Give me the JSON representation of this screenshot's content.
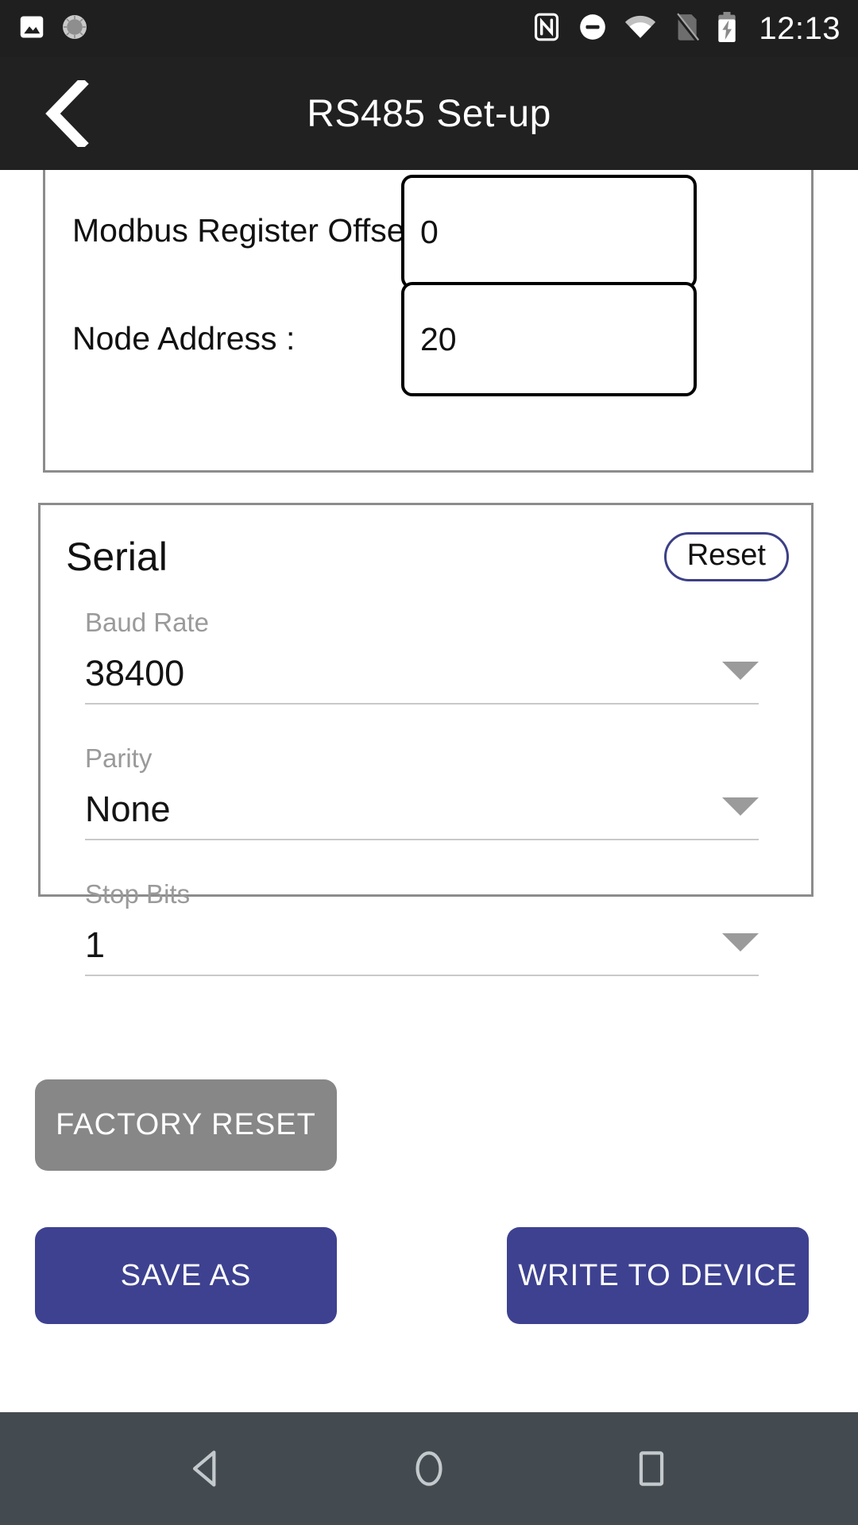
{
  "status_bar": {
    "icons_left": [
      "image-icon",
      "brightness-icon"
    ],
    "icons_right": [
      "nfc-icon",
      "do-not-disturb-icon",
      "wifi-icon",
      "no-sim-icon",
      "battery-charging-icon"
    ],
    "time": "12:13"
  },
  "app_bar": {
    "back_icon": "back-chevron-icon",
    "title": "RS485 Set-up"
  },
  "modbus_card": {
    "fields": [
      {
        "label": "Modbus Register Offset :",
        "value": "0",
        "placeholder": "0"
      },
      {
        "label": "Node Address :",
        "value": "20",
        "placeholder": "0"
      }
    ]
  },
  "serial_card": {
    "title": "Serial",
    "reset_label": "Reset",
    "selects": [
      {
        "label": "Baud Rate",
        "value": "38400",
        "caret": "chevron-down-icon"
      },
      {
        "label": "Parity",
        "value": "None",
        "caret": "chevron-down-icon"
      },
      {
        "label": "Stop Bits",
        "value": "1",
        "caret": "chevron-down-icon"
      }
    ]
  },
  "actions": {
    "factory_reset": "FACTORY RESET",
    "save_as": "SAVE AS",
    "write_to_device": "WRITE TO DEVICE"
  },
  "nav_bar": {
    "back": "nav-back-icon",
    "home": "nav-home-icon",
    "recents": "nav-recents-icon"
  },
  "colors": {
    "accent": "#3d4190",
    "disabled": "#878787",
    "appbar": "#212121",
    "navbar": "#434b50",
    "label_muted": "#9a9a9a"
  }
}
